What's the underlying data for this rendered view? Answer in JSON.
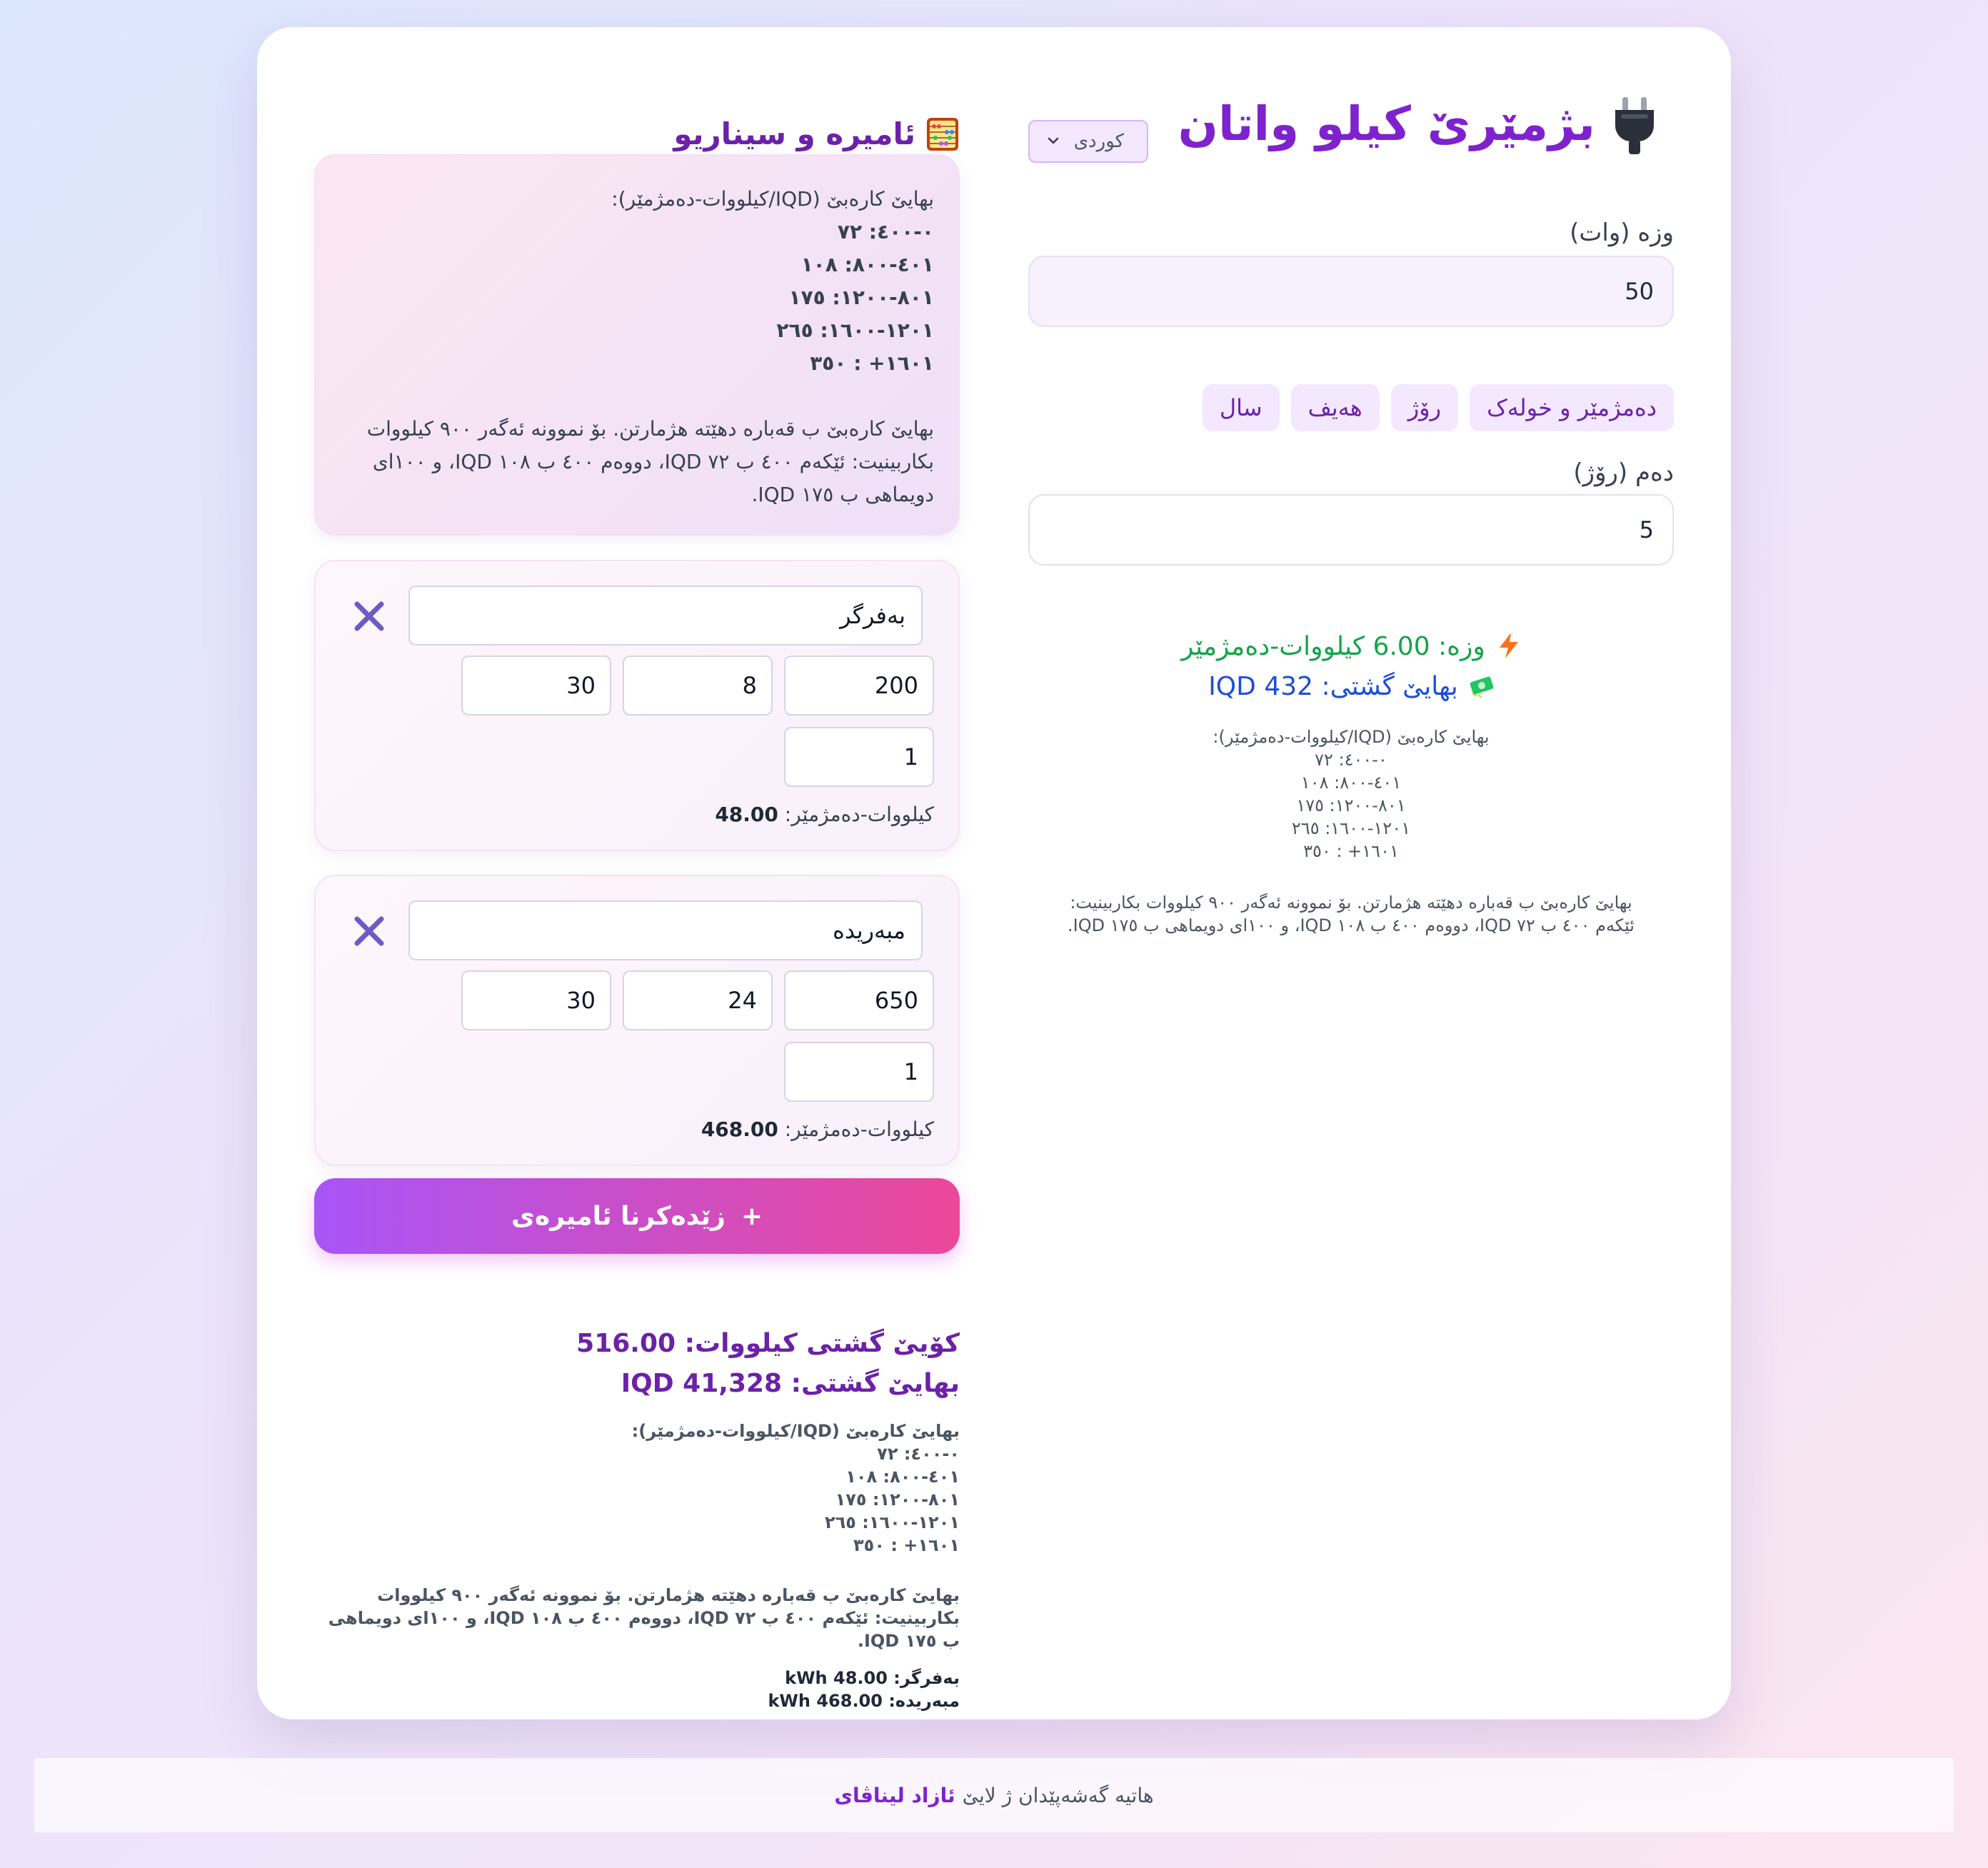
{
  "app": {
    "title": "بژمێرێ کیلو واتان",
    "language_selected": "کوردی"
  },
  "calculator": {
    "power_label": "وزە (وات)",
    "power_value": "50",
    "period_buttons": [
      "دەمژمێر و خولەک",
      "رۆژ",
      "هەیف",
      "سال"
    ],
    "duration_label": "دەم (رۆژ)",
    "duration_value": "5",
    "result_energy": "وزە: 6.00 کیلووات-دەمژمێر",
    "result_cost": "بهایێ گشتی: 432 IQD",
    "tariff_lines": [
      "بهایێ کارەبێ (IQD/کیلووات-دەمژمێر):",
      "٠-٤٠٠: ٧٢",
      "٤٠١-٨٠٠: ١٠٨",
      "٨٠١-١٢٠٠: ١٧٥",
      "١٢٠١-١٦٠٠: ٢٦٥",
      "١٦٠١+ : ٣٥٠"
    ],
    "tariff_note": "بهایێ کارەبێ ب قەباره دهێتە هژمارتن. بۆ نموونە ئەگەر ٩٠٠ کیلووات بکاربینیت: ئێکەم ٤٠٠ ب ٧٢ IQD، دووەم ٤٠٠ ب ١٠٨ IQD، و ١٠٠ای دویماهی ب ١٧٥ IQD."
  },
  "appliances_section": {
    "title": "ئامیرە و سیناریو",
    "tariff_box": {
      "lines": [
        "بهایێ کارەبێ (IQD/کیلووات-دەمژمێر):",
        "٠-٤٠٠: ٧٢",
        "٤٠١-٨٠٠: ١٠٨",
        "٨٠١-١٢٠٠: ١٧٥",
        "١٢٠١-١٦٠٠: ٢٦٥",
        "١٦٠١+ : ٣٥٠"
      ],
      "note": "بهایێ کارەبێ ب قەباره دهێتە هژمارتن. بۆ نموونە ئەگەر ٩٠٠ کیلووات بکاربینیت: ئێکەم ٤٠٠ ب ٧٢ IQD، دووەم ٤٠٠ ب ١٠٨ IQD، و ١٠٠ای دویماهی ب ١٧٥ IQD."
    },
    "appliances": [
      {
        "name": "بەفرگر",
        "watts": "200",
        "hours": "8",
        "days": "30",
        "quantity": "1",
        "kwh_label": "کیلووات-دەمژمێر:",
        "kwh_value": "48.00"
      },
      {
        "name": "مبەریدە",
        "watts": "650",
        "hours": "24",
        "days": "30",
        "quantity": "1",
        "kwh_label": "کیلووات-دەمژمێر:",
        "kwh_value": "468.00"
      }
    ],
    "add_button": "زێدەکرنا ئامیرەی",
    "add_button_icon": "+",
    "summary": {
      "total_kwh": "کۆیێ گشتی کیلووات: 516.00",
      "total_cost": "بهایێ گشتی: IQD 41,328",
      "tariff_lines": [
        "بهایێ کارەبێ (IQD/کیلووات-دەمژمێر):",
        "٠-٤٠٠: ٧٢",
        "٤٠١-٨٠٠: ١٠٨",
        "٨٠١-١٢٠٠: ١٧٥",
        "١٢٠١-١٦٠٠: ٢٦٥",
        "١٦٠١+ : ٣٥٠"
      ],
      "tariff_note": "بهایێ کارەبێ ب قەباره دهێتە هژمارتن. بۆ نموونە ئەگەر ٩٠٠ کیلووات بکاربینیت: ئێکەم ٤٠٠ ب ٧٢ IQD، دووەم ٤٠٠ ب ١٠٨ IQD، و ١٠٠ای دویماهی ب ١٧٥ IQD.",
      "items": [
        {
          "name": "بەفرگر:",
          "value": "48.00 kWh"
        },
        {
          "name": "مبەریدە:",
          "value": "468.00 kWh"
        }
      ]
    }
  },
  "footer": {
    "text": "هاتیە گەشەپێدان ژ لایێ",
    "author": "ئازاد لیناڤای"
  },
  "icons": {
    "title": "plug-icon",
    "appliances_title": "abacus-icon",
    "delete": "close-icon",
    "energy": "lightning-icon",
    "cost": "money-icon",
    "select": "chevron-down-icon"
  },
  "colors": {
    "accent": "#7e22ce",
    "energy": "#16a34a",
    "cost": "#1d4ed8",
    "button_gradient_start": "#a855f7",
    "button_gradient_end": "#ec4899",
    "delete_icon": "#6d5bc4"
  }
}
